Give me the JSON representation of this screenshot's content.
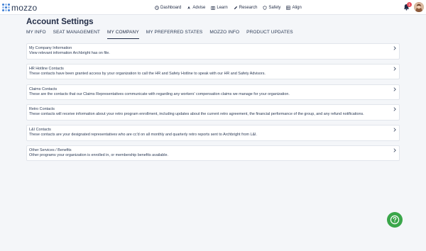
{
  "app": {
    "logo_text": "mozzo"
  },
  "nav": {
    "items": [
      {
        "label": "Dashboard",
        "icon": "clock-icon"
      },
      {
        "label": "Advise",
        "icon": "compass-icon"
      },
      {
        "label": "Learn",
        "icon": "book-icon"
      },
      {
        "label": "Research",
        "icon": "pencil-icon"
      },
      {
        "label": "Safety",
        "icon": "shield-icon"
      },
      {
        "label": "Align",
        "icon": "grid-icon"
      }
    ],
    "notifications_count": "1"
  },
  "page": {
    "title": "Account Settings"
  },
  "tabs": [
    {
      "label": "MY INFO",
      "active": false
    },
    {
      "label": "SEAT MANAGEMENT",
      "active": false
    },
    {
      "label": "MY COMPANY",
      "active": true
    },
    {
      "label": "MY PREFERRED STATES",
      "active": false
    },
    {
      "label": "MOZZO INFO",
      "active": false
    },
    {
      "label": "PRODUCT UPDATES",
      "active": false
    }
  ],
  "cards": [
    {
      "title": "My Company Information",
      "description": "View relevant information Archbright has on file."
    },
    {
      "title": "HR Hotline Contacts",
      "description": "These contacts have been granted access by your organization to call the HR and Safety Hotline to speak with our HR and Safety Advisors."
    },
    {
      "title": "Claims Contacts",
      "description": "These are the contacts that our Claims Representatives communicate with regarding any workers' compensation claims we manage for your organization."
    },
    {
      "title": "Retro Contacts",
      "description": "These contacts will receive information about your retro program enrollment, including updates about the current retro agreement, the financial performance of the group, and any refund notifications."
    },
    {
      "title": "L&I Contacts",
      "description": "These contacts are your designated representatives who are cc'd on all monthly and quarterly retro reports sent to Archbright from L&I."
    },
    {
      "title": "Other Services / Benefits",
      "description": "Other programs your organization is enrolled in, or membership benefits available."
    }
  ],
  "colors": {
    "accent": "#1f2a44",
    "help_button": "#3aa64a",
    "badge": "#e84c5b",
    "logo": "#3d7fd6"
  }
}
